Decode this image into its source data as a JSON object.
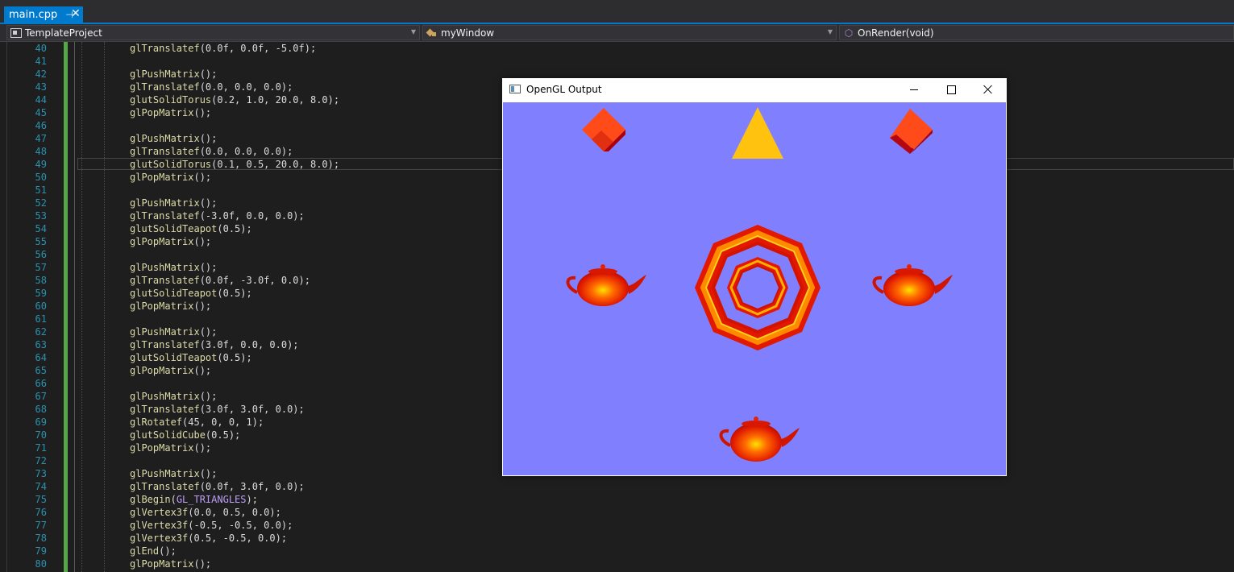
{
  "tab": {
    "title": "main.cpp",
    "pin_glyph": "⊣",
    "close_glyph": "✕"
  },
  "navbar": {
    "project": "TemplateProject",
    "scope": "myWindow",
    "member": "OnRender(void)"
  },
  "editor": {
    "current_line": 49,
    "lines": [
      {
        "n": "40",
        "code": "glTranslatef(0.0f, 0.0f, -5.0f);"
      },
      {
        "n": "41",
        "code": ""
      },
      {
        "n": "42",
        "code": "glPushMatrix();"
      },
      {
        "n": "43",
        "code": "glTranslatef(0.0, 0.0, 0.0);"
      },
      {
        "n": "44",
        "code": "glutSolidTorus(0.2, 1.0, 20.0, 8.0);"
      },
      {
        "n": "45",
        "code": "glPopMatrix();"
      },
      {
        "n": "46",
        "code": ""
      },
      {
        "n": "47",
        "code": "glPushMatrix();"
      },
      {
        "n": "48",
        "code": "glTranslatef(0.0, 0.0, 0.0);"
      },
      {
        "n": "49",
        "code": "glutSolidTorus(0.1, 0.5, 20.0, 8.0);"
      },
      {
        "n": "50",
        "code": "glPopMatrix();"
      },
      {
        "n": "51",
        "code": ""
      },
      {
        "n": "52",
        "code": "glPushMatrix();"
      },
      {
        "n": "53",
        "code": "glTranslatef(-3.0f, 0.0, 0.0);"
      },
      {
        "n": "54",
        "code": "glutSolidTeapot(0.5);"
      },
      {
        "n": "55",
        "code": "glPopMatrix();"
      },
      {
        "n": "56",
        "code": ""
      },
      {
        "n": "57",
        "code": "glPushMatrix();"
      },
      {
        "n": "58",
        "code": "glTranslatef(0.0f, -3.0f, 0.0);"
      },
      {
        "n": "59",
        "code": "glutSolidTeapot(0.5);"
      },
      {
        "n": "60",
        "code": "glPopMatrix();"
      },
      {
        "n": "61",
        "code": ""
      },
      {
        "n": "62",
        "code": "glPushMatrix();"
      },
      {
        "n": "63",
        "code": "glTranslatef(3.0f, 0.0, 0.0);"
      },
      {
        "n": "64",
        "code": "glutSolidTeapot(0.5);"
      },
      {
        "n": "65",
        "code": "glPopMatrix();"
      },
      {
        "n": "66",
        "code": ""
      },
      {
        "n": "67",
        "code": "glPushMatrix();"
      },
      {
        "n": "68",
        "code": "glTranslatef(3.0f, 3.0f, 0.0);"
      },
      {
        "n": "69",
        "code": "glRotatef(45, 0, 0, 1);"
      },
      {
        "n": "70",
        "code": "glutSolidCube(0.5);"
      },
      {
        "n": "71",
        "code": "glPopMatrix();"
      },
      {
        "n": "72",
        "code": ""
      },
      {
        "n": "73",
        "code": "glPushMatrix();"
      },
      {
        "n": "74",
        "code": "glTranslatef(0.0f, 3.0f, 0.0);"
      },
      {
        "n": "75",
        "code": "glBegin(GL_TRIANGLES);"
      },
      {
        "n": "76",
        "code": "glVertex3f(0.0, 0.5, 0.0);"
      },
      {
        "n": "77",
        "code": "glVertex3f(-0.5, -0.5, 0.0);"
      },
      {
        "n": "78",
        "code": "glVertex3f(0.5, -0.5, 0.0);"
      },
      {
        "n": "79",
        "code": "glEnd();"
      },
      {
        "n": "80",
        "code": "glPopMatrix();"
      }
    ]
  },
  "gl_window": {
    "title": "OpenGL Output",
    "background": "#8080ff"
  },
  "colors": {
    "accent": "#007acc",
    "line_number": "#2b91af",
    "code_text": "#dcdcdc",
    "change_bar": "#57a64a",
    "teapot_red": "#e01a00",
    "teapot_yellow": "#ffd000",
    "cube_red": "#ff4a1a",
    "triangle_yellow": "#ffc20e"
  }
}
